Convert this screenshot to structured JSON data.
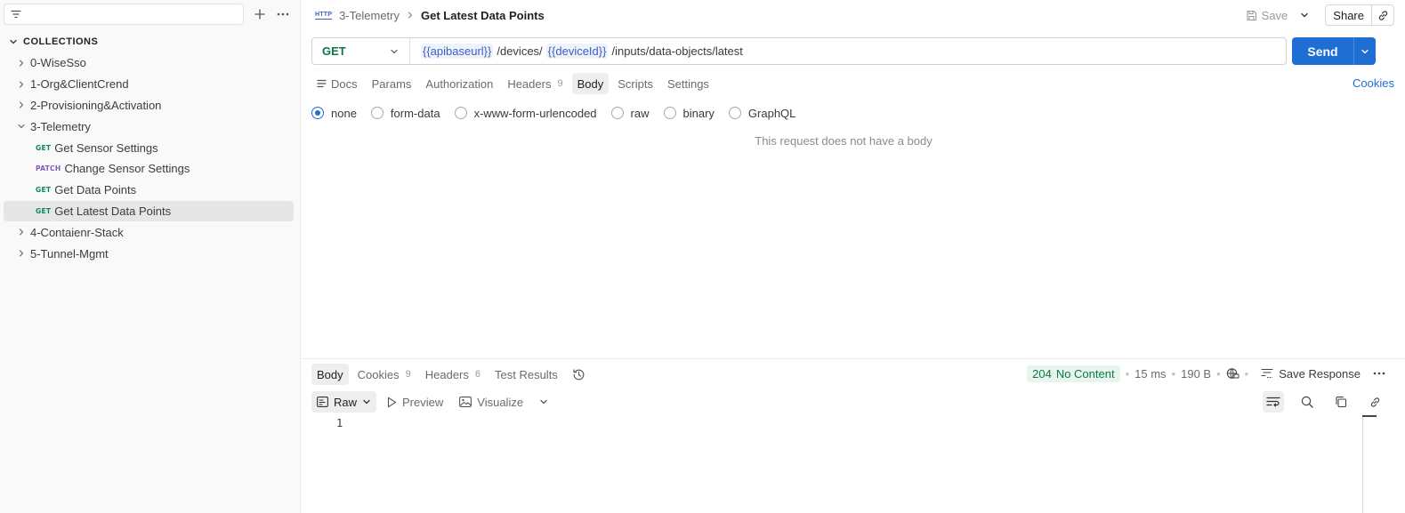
{
  "sidebar": {
    "collections_label": "COLLECTIONS",
    "tree": [
      {
        "label": "0-WiseSso",
        "expanded": false
      },
      {
        "label": "1-Org&ClientCrend",
        "expanded": false
      },
      {
        "label": "2-Provisioning&Activation",
        "expanded": false
      },
      {
        "label": "3-Telemetry",
        "expanded": true
      },
      {
        "method": "GET",
        "label": "Get Sensor Settings"
      },
      {
        "method": "PATCH",
        "label": "Change Sensor Settings"
      },
      {
        "method": "GET",
        "label": "Get Data Points"
      },
      {
        "method": "GET",
        "label": "Get Latest Data Points",
        "selected": true
      },
      {
        "label": "4-Contaienr-Stack",
        "expanded": false
      },
      {
        "label": "5-Tunnel-Mgmt",
        "expanded": false
      }
    ]
  },
  "header": {
    "badge": "HTTP",
    "parent": "3-Telemetry",
    "current": "Get Latest Data Points",
    "save_label": "Save",
    "share_label": "Share"
  },
  "request": {
    "method": "GET",
    "url_parts": {
      "var1": "{{apibaseurl}}",
      "seg1": "/devices/",
      "var2": "{{deviceId}}",
      "seg2": "/inputs/data-objects/latest"
    },
    "send_label": "Send",
    "cookies_label": "Cookies",
    "tabs": {
      "docs": "Docs",
      "params": "Params",
      "authorization": "Authorization",
      "headers": "Headers",
      "headers_count": "9",
      "body": "Body",
      "scripts": "Scripts",
      "settings": "Settings"
    },
    "body_options": [
      "none",
      "form-data",
      "x-www-form-urlencoded",
      "raw",
      "binary",
      "GraphQL"
    ],
    "body_selected": "none",
    "no_body_text": "This request does not have a body"
  },
  "response": {
    "tabs": {
      "body": "Body",
      "cookies": "Cookies",
      "cookies_count": "9",
      "headers": "Headers",
      "headers_count": "6",
      "tests": "Test Results"
    },
    "status_code": "204",
    "status_text": "No Content",
    "time": "15 ms",
    "size": "190 B",
    "save_response_label": "Save Response",
    "view": {
      "raw": "Raw",
      "preview": "Preview",
      "visualize": "Visualize"
    },
    "line_number": "1"
  },
  "colors": {
    "accent": "#1f6ed4",
    "get": "#0b8a4b",
    "patch": "#7e5ab6",
    "status_ok": "#0b7a45"
  },
  "icons": [
    "filter-icon",
    "plus-icon",
    "more-icon",
    "chevron-down-icon",
    "chevron-right-icon",
    "save-icon",
    "link-icon",
    "docs-icon",
    "history-icon",
    "globe-icon",
    "save-response-icon",
    "raw-icon",
    "play-icon",
    "image-icon",
    "wrap-icon",
    "search-icon",
    "copy-icon"
  ]
}
